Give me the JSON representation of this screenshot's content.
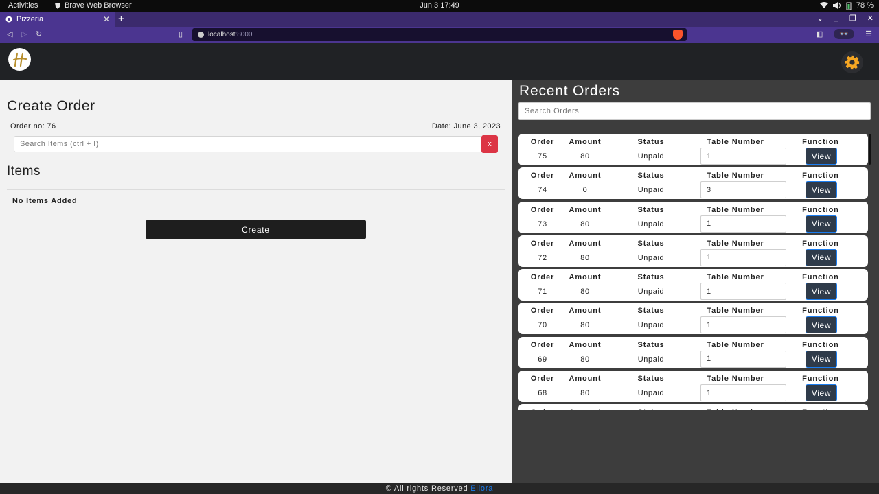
{
  "system": {
    "activities": "Activities",
    "app_name": "Brave Web Browser",
    "clock": "Jun 3  17:49",
    "battery": "78 %"
  },
  "browser": {
    "tab_title": "Pizzeria",
    "url_host": "localhost",
    "url_port": ":8000"
  },
  "create_order": {
    "title": "Create Order",
    "order_no": "Order no: 76",
    "date": "Date: June 3, 2023",
    "search_placeholder": "Search Items (ctrl + I)",
    "clear_label": "x",
    "items_title": "Items",
    "no_items": "No Items Added",
    "create_label": "Create"
  },
  "recent_orders": {
    "title": "Recent Orders",
    "search_placeholder": "Search Orders",
    "headers": {
      "order": "Order",
      "amount": "Amount",
      "status": "Status",
      "table": "Table Number",
      "function": "Function"
    },
    "view_label": "View",
    "rows": [
      {
        "order": "75",
        "amount": "80",
        "status": "Unpaid",
        "table": "1"
      },
      {
        "order": "74",
        "amount": "0",
        "status": "Unpaid",
        "table": "3"
      },
      {
        "order": "73",
        "amount": "80",
        "status": "Unpaid",
        "table": "1"
      },
      {
        "order": "72",
        "amount": "80",
        "status": "Unpaid",
        "table": "1"
      },
      {
        "order": "71",
        "amount": "80",
        "status": "Unpaid",
        "table": "1"
      },
      {
        "order": "70",
        "amount": "80",
        "status": "Unpaid",
        "table": "1"
      },
      {
        "order": "69",
        "amount": "80",
        "status": "Unpaid",
        "table": "1"
      },
      {
        "order": "68",
        "amount": "80",
        "status": "Unpaid",
        "table": "1"
      },
      {
        "order": "",
        "amount": "",
        "status": "",
        "table": ""
      }
    ]
  },
  "footer": {
    "text": "© All rights Reserved",
    "brand": "Ellora"
  },
  "colors": {
    "accent_blue": "#1a7df0",
    "danger_red": "#dc3545",
    "gear_orange": "#f5a623",
    "logo_gold": "#b8902f"
  },
  "icons": {
    "logo": "pizzeria-logo",
    "settings": "gear-icon",
    "brave": "brave-lion-icon"
  }
}
